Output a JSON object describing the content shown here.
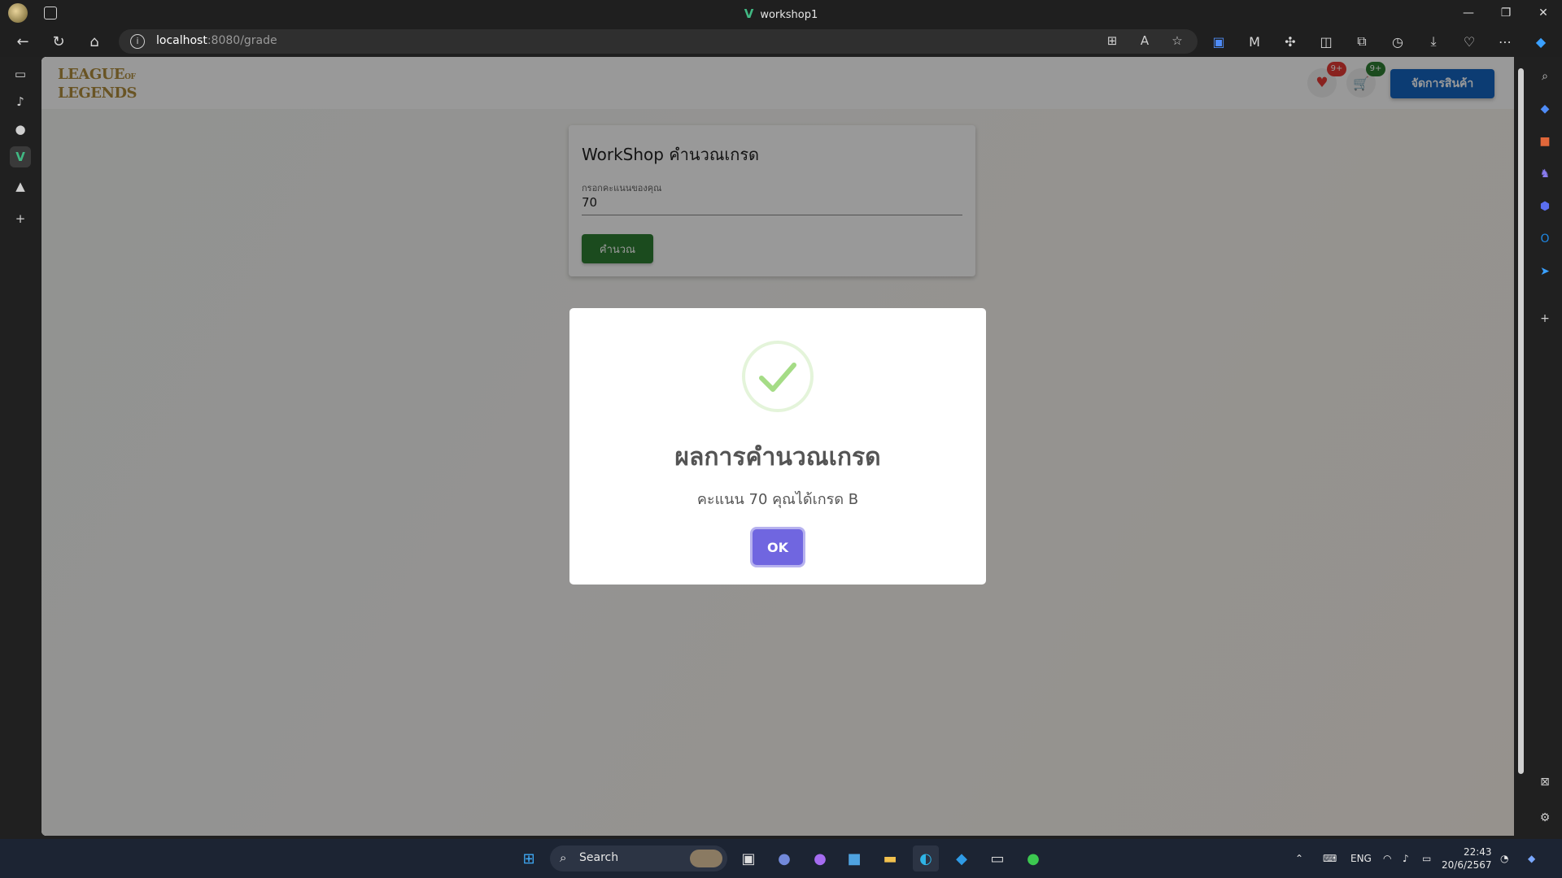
{
  "window": {
    "title": "workshop1",
    "vue_logo": "V",
    "controls": [
      "—",
      "❐",
      "✕"
    ]
  },
  "browser": {
    "url_host": "localhost",
    "url_rest": ":8080/grade"
  },
  "app": {
    "logo_line1": "LEAGUE",
    "logo_of": "OF",
    "logo_line2": "LEGENDS",
    "favorites_badge": "9+",
    "cart_badge": "9+",
    "manage_button": "จัดการสินค้า"
  },
  "card": {
    "title": "WorkShop คำนวณเกรด",
    "field_label": "กรอกคะแนนของคุณ",
    "field_value": "70",
    "calc_button": "คำนวณ"
  },
  "dialog": {
    "title": "ผลการคำนวณเกรด",
    "text": "คะแนน 70 คุณได้เกรด B",
    "ok_button": "OK",
    "success_color": "#a5dc86",
    "button_color": "#7066e0"
  },
  "taskbar": {
    "search_placeholder": "Search",
    "language": "ENG",
    "time": "22:43",
    "date": "20/6/2567"
  }
}
